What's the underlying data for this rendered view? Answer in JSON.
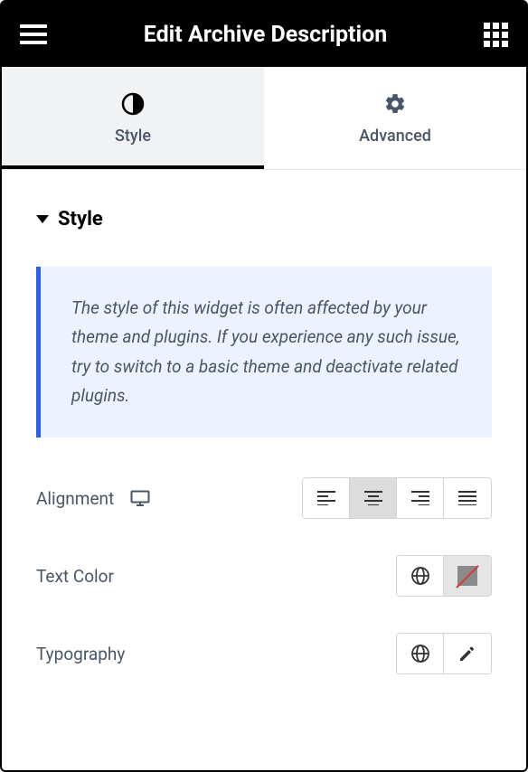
{
  "header": {
    "title": "Edit Archive Description"
  },
  "tabs": {
    "style": {
      "label": "Style"
    },
    "advanced": {
      "label": "Advanced"
    }
  },
  "section": {
    "title": "Style"
  },
  "notice": {
    "text": "The style of this widget is often affected by your theme and plugins. If you experience any such issue, try to switch to a basic theme and deactivate related plugins."
  },
  "controls": {
    "alignment": {
      "label": "Alignment"
    },
    "text_color": {
      "label": "Text Color"
    },
    "typography": {
      "label": "Typography"
    }
  }
}
